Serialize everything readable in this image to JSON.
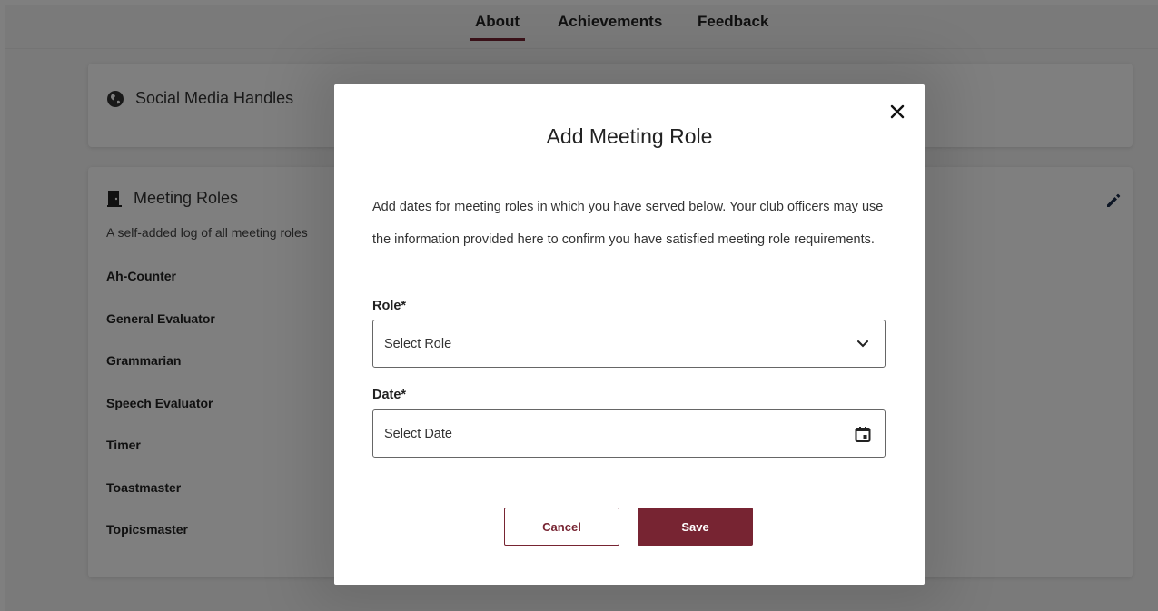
{
  "tabs": [
    {
      "label": "About",
      "active": true
    },
    {
      "label": "Achievements",
      "active": false
    },
    {
      "label": "Feedback",
      "active": false
    }
  ],
  "social_card": {
    "title": "Social Media Handles",
    "icon": "globe-icon"
  },
  "roles_card": {
    "title": "Meeting Roles",
    "icon": "door-icon",
    "subtitle": "A self-added log of all meeting roles",
    "edit_icon": "pencil-icon",
    "roles": [
      "Ah-Counter",
      "General Evaluator",
      "Grammarian",
      "Speech Evaluator",
      "Timer",
      "Toastmaster",
      "Topicsmaster"
    ]
  },
  "modal": {
    "title": "Add Meeting Role",
    "description": "Add dates for meeting roles in which you have served below. Your club officers may use the information provided here to confirm you have satisfied meeting role requirements.",
    "role_label": "Role*",
    "role_placeholder": "Select Role",
    "date_label": "Date*",
    "date_placeholder": "Select Date",
    "cancel_label": "Cancel",
    "save_label": "Save",
    "close_icon": "close-icon",
    "dropdown_icon": "chevron-down-icon",
    "calendar_icon": "calendar-icon"
  },
  "colors": {
    "brand": "#772432",
    "overlay": "rgba(0,0,0,0.5)"
  }
}
